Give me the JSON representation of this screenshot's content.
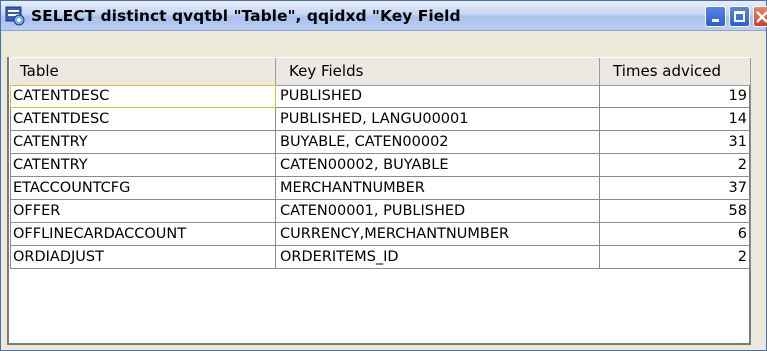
{
  "window": {
    "title": "SELECT  distinct qvqtbl \"Table\", qqidxd \"Key Fields\", coun...",
    "controls": {
      "minimize": "minimize",
      "maximize": "maximize",
      "close": "close"
    },
    "icon": "database-query-icon"
  },
  "table": {
    "columns": [
      "Table",
      "Key Fields",
      "Times adviced"
    ],
    "rows": [
      [
        "CATENTDESC",
        "PUBLISHED",
        "19"
      ],
      [
        "CATENTDESC",
        "PUBLISHED, LANGU00001",
        "14"
      ],
      [
        "CATENTRY",
        "BUYABLE, CATEN00002",
        "31"
      ],
      [
        "CATENTRY",
        "CATEN00002, BUYABLE",
        "2"
      ],
      [
        "ETACCOUNTCFG",
        "MERCHANTNUMBER",
        "37"
      ],
      [
        "OFFER",
        "CATEN00001, PUBLISHED",
        "58"
      ],
      [
        "OFFLINECARDACCOUNT",
        "CURRENCY,MERCHANTNUMBER",
        "6"
      ],
      [
        "ORDIADJUST",
        "ORDERITEMS_ID",
        "2"
      ]
    ]
  },
  "colors": {
    "titlebar": "#c4d5f4",
    "close_button": "#c7401e",
    "focus_outline": "#d7c23a"
  }
}
